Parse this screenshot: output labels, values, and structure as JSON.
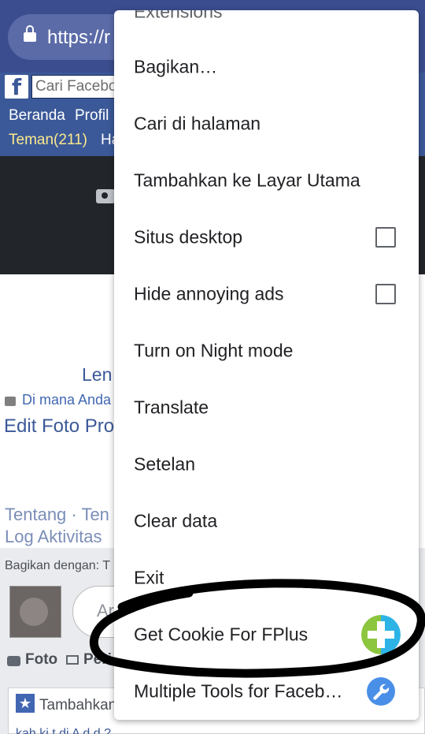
{
  "browser": {
    "url_partial": "https://r",
    "lock_icon": "lock-icon"
  },
  "facebook": {
    "logo_letter": "f",
    "search_placeholder": "Cari Facebo",
    "nav": {
      "beranda": "Beranda",
      "profil": "Profil",
      "teman": "Teman(211)",
      "ha": "Ha"
    },
    "profile": {
      "name_partial": "Len",
      "location_partial": "Di mana Anda",
      "edit_photo_partial": "Edit Foto Pro",
      "about_partial": "Tentang · Ten",
      "activity_partial": "Log Aktivitas",
      "share_with": "Bagikan dengan: T",
      "composer_partial": "Ar",
      "photo": "Foto",
      "peri_partial": "Peri",
      "add_partial": "Tambahkan",
      "bottom_partial": "kah   ki   t   di   A  d   d   ?"
    }
  },
  "menu": {
    "items": [
      {
        "label": "Extensions"
      },
      {
        "label": "Bagikan…"
      },
      {
        "label": "Cari di halaman"
      },
      {
        "label": "Tambahkan ke Layar Utama"
      },
      {
        "label": "Situs desktop",
        "checked": false
      },
      {
        "label": "Hide annoying ads",
        "checked": false
      },
      {
        "label": "Turn on Night mode"
      },
      {
        "label": "Translate"
      },
      {
        "label": "Setelan"
      },
      {
        "label": "Clear data"
      },
      {
        "label": "Exit"
      },
      {
        "label": "Get Cookie For FPlus",
        "icon": "fplus-plus-icon"
      },
      {
        "label": "Multiple Tools for Faceb…",
        "icon": "wrench-icon"
      }
    ]
  },
  "colors": {
    "browser_bar": "#3b4d8f",
    "facebook_blue": "#3b5998",
    "link_blue": "#4267b2",
    "menu_text": "#202124"
  }
}
